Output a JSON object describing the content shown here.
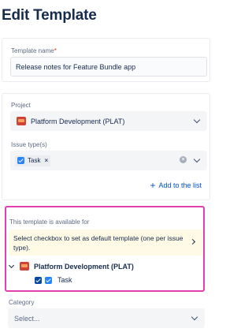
{
  "page": {
    "title": "Edit Template"
  },
  "template_name": {
    "label": "Template name",
    "required_mark": "*",
    "value": "Release notes for Feature Bundle app"
  },
  "project": {
    "label": "Project",
    "value": "Platform Development (PLAT)",
    "icon": "project-icon"
  },
  "issue_types": {
    "label": "Issue type(s)",
    "tags": [
      {
        "label": "Task",
        "icon": "task-checkbox-icon"
      }
    ],
    "remove_glyph": "×",
    "clear_glyph": "×"
  },
  "add_link": {
    "plus": "+",
    "label": "Add to the list"
  },
  "availability": {
    "label": "This template is available for",
    "notice": "Select checkbox to set as default template (one per issue type).",
    "project_label": "Platform Development (PLAT)",
    "task_label": "Task"
  },
  "category": {
    "label": "Category",
    "placeholder": "Select..."
  },
  "colors": {
    "link": "#0052cc",
    "highlight_border": "#e33fae",
    "notice_bg": "#fefae6",
    "required": "#de350b"
  }
}
